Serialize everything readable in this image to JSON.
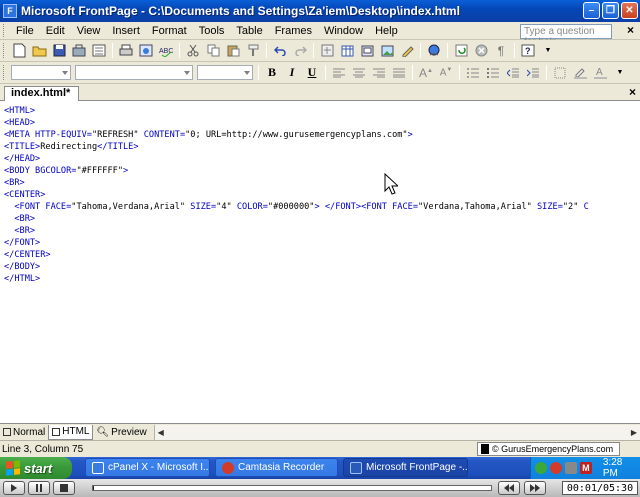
{
  "window": {
    "title": "Microsoft FrontPage - C:\\Documents and Settings\\Za'iem\\Desktop\\index.html"
  },
  "menu": {
    "items": [
      "File",
      "Edit",
      "View",
      "Insert",
      "Format",
      "Tools",
      "Table",
      "Frames",
      "Window",
      "Help"
    ],
    "help_placeholder": "Type a question for help"
  },
  "document": {
    "tab_label": "index.html*"
  },
  "code_lines": [
    "<HTML>",
    "<HEAD>",
    "<META HTTP-EQUIV=\"REFRESH\" CONTENT=\"0; URL=http://www.gurusemergencyplans.com\">",
    "<TITLE>Redirecting</TITLE>",
    "</HEAD>",
    "<BODY BGCOLOR=\"#FFFFFF\">",
    "<BR>",
    "<CENTER>",
    "  <FONT FACE=\"Tahoma,Verdana,Arial\" SIZE=\"4\" COLOR=\"#000000\"> </FONT><FONT FACE=\"Verdana,Tahoma,Arial\" SIZE=\"2\" C",
    "  <BR>",
    "  <BR>",
    "</FONT>",
    "</CENTER>",
    "</BODY>",
    "</HTML>"
  ],
  "view_tabs": {
    "normal": "Normal",
    "html": "HTML",
    "preview": "Preview"
  },
  "status": {
    "position": "Line 3, Column 75",
    "watermark": "© GurusEmergencyPlans.com"
  },
  "taskbar": {
    "start_label": "start",
    "tasks": [
      {
        "label": "cPanel X - Microsoft I...",
        "icon_color": "#3a7be0"
      },
      {
        "label": "Camtasia Recorder",
        "icon_color": "#d23a2a"
      },
      {
        "label": "Microsoft FrontPage -...",
        "icon_color": "#2a5ab8"
      }
    ],
    "clock": "3:28 PM"
  },
  "player": {
    "time": "00:01/05:30",
    "progress": 0.003
  },
  "colors": {
    "tag_color": "#0000c0",
    "titlebar": "#0a5fd8"
  }
}
